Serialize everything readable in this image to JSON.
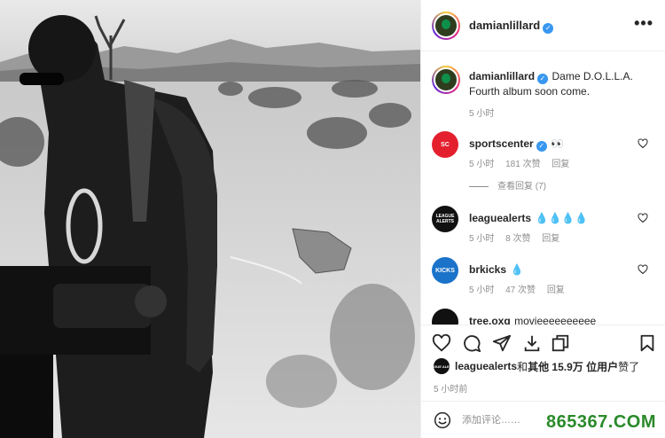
{
  "post": {
    "photo_icon": "black-and-white-photo-man-with-camera-in-desert"
  },
  "header": {
    "username": "damianlillard",
    "verified_icon": "verified-badge-icon",
    "more_label": "•••"
  },
  "caption": {
    "username": "damianlillard",
    "text": "Dame D.O.L.L.A. Fourth album soon come.",
    "time": "5 小时"
  },
  "comments": [
    {
      "username": "sportscenter",
      "avatar_text": "SC",
      "avatar_color": "#e4202e",
      "text": "👀",
      "time": "5 小时",
      "likes": "181 次赞",
      "reply_label": "回复",
      "view_replies": "查看回复 (7)"
    },
    {
      "username": "leaguealerts",
      "avatar_text": "LEAGUE ALERTS",
      "avatar_color": "#111111",
      "text": "💧💧💧💧",
      "time": "5 小时",
      "likes": "8 次赞",
      "reply_label": "回复"
    },
    {
      "username": "brkicks",
      "avatar_text": "KICKS",
      "avatar_color": "#1a73c9",
      "text": "💧",
      "time": "5 小时",
      "likes": "47 次赞",
      "reply_label": "回复"
    },
    {
      "username": "tree.oxg",
      "avatar_text": "",
      "avatar_color": "#111111",
      "text": "movieeeeeeeeee"
    }
  ],
  "likes_line": {
    "avatar_text": "LEAGUE ALERTS",
    "user": "leaguealerts",
    "and": " 和 ",
    "others": "其他 15.9万 位用户",
    "suffix": " 赞了"
  },
  "post_time": "5 小时前",
  "comment_box": {
    "placeholder": "添加评论……"
  },
  "watermark": "865367.COM",
  "colors": {
    "verified": "#3897f0",
    "secondary_text": "#8e8e8e",
    "watermark": "#2a8a2a"
  }
}
